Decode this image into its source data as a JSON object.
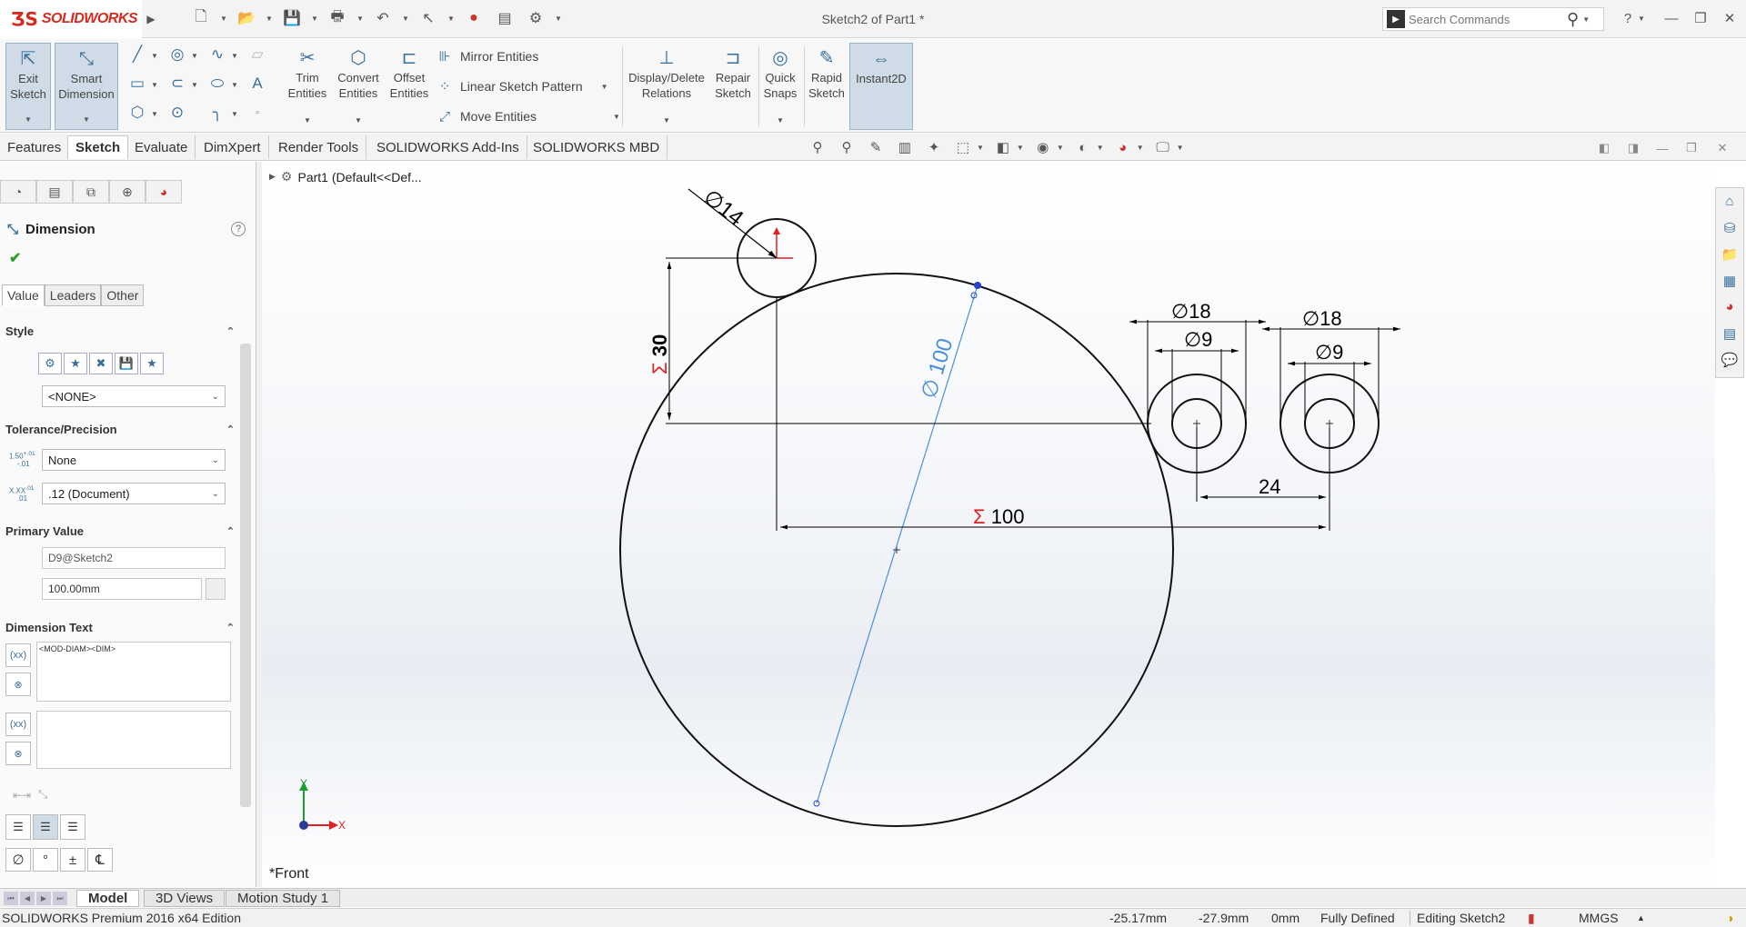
{
  "app": {
    "brand": "SOLIDWORKS",
    "document_title": "Sketch2 of Part1 *",
    "search_placeholder": "Search Commands"
  },
  "ribbon": {
    "exit_sketch": "Exit Sketch",
    "smart_dimension": "Smart Dimension",
    "trim_entities": "Trim Entities",
    "convert_entities": "Convert Entities",
    "offset_entities": "Offset Entities",
    "mirror_entities": "Mirror Entities",
    "linear_sketch_pattern": "Linear Sketch Pattern",
    "move_entities": "Move Entities",
    "display_delete_relations": "Display/Delete Relations",
    "repair_sketch": "Repair Sketch",
    "quick_snaps": "Quick Snaps",
    "rapid_sketch": "Rapid Sketch",
    "instant2d": "Instant2D"
  },
  "command_tabs": [
    "Features",
    "Sketch",
    "Evaluate",
    "DimXpert",
    "Render Tools",
    "SOLIDWORKS Add-Ins",
    "SOLIDWORKS MBD"
  ],
  "property_manager": {
    "title": "Dimension",
    "subtabs": [
      "Value",
      "Leaders",
      "Other"
    ],
    "style_title": "Style",
    "style_value": "<NONE>",
    "tolerance_title": "Tolerance/Precision",
    "tolerance_type": "None",
    "precision": ".12 (Document)",
    "primary_value_title": "Primary Value",
    "primary_name": "D9@Sketch2",
    "primary_value": "100.00mm",
    "dimension_text_title": "Dimension Text",
    "dimension_text": "<MOD-DIAM><DIM>"
  },
  "tree": {
    "root": "Part1  (Default<<Def..."
  },
  "drawing": {
    "dim_small_circle": "14",
    "dim_height": "30",
    "dim_big_diameter": "100",
    "dim_width": "100",
    "dim_outer_1": "18",
    "dim_inner_1": "9",
    "dim_outer_2": "18",
    "dim_inner_2": "9",
    "dim_spacing": "24",
    "diam_symbol": "∅",
    "driven_symbol": "Σ",
    "axis_x": "X",
    "axis_y": "Y"
  },
  "view_label": "*Front",
  "bottom_tabs": [
    "Model",
    "3D Views",
    "Motion Study 1"
  ],
  "status": {
    "edition": "SOLIDWORKS Premium 2016 x64 Edition",
    "x": "-25.17mm",
    "y": "-27.9mm",
    "z": "0mm",
    "state": "Fully Defined",
    "mode": "Editing Sketch2",
    "units": "MMGS"
  },
  "colors": {
    "selected_dimension": "#4a90d9",
    "driven_marker": "#e02020",
    "active_button": "#cfdbe6"
  }
}
